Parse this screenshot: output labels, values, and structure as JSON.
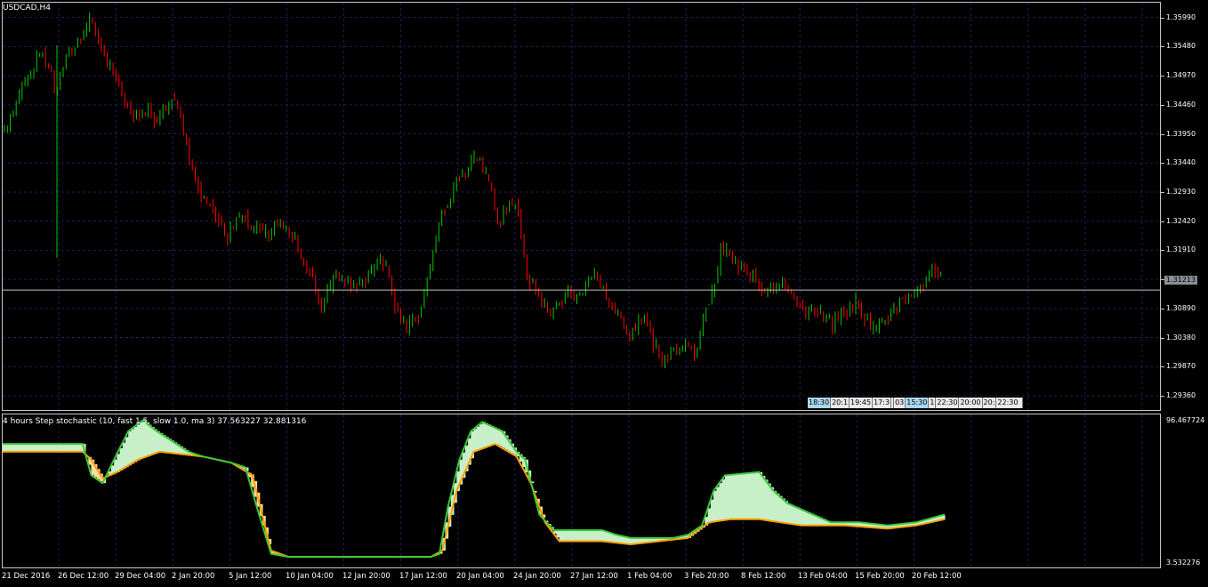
{
  "chart": {
    "symbol_title": "USDCAD,H4",
    "current_price": "1.31213",
    "price_labels": [
      "1.35990",
      "1.35480",
      "1.34970",
      "1.34460",
      "1.33950",
      "1.33440",
      "1.32930",
      "1.32420",
      "1.31910",
      "1.31400",
      "1.30890",
      "1.30380",
      "1.29870",
      "1.29360"
    ],
    "time_labels": [
      "21 Dec 2016",
      "26 Dec 12:00",
      "29 Dec 04:00",
      "2 Jan 20:00",
      "5 Jan 12:00",
      "10 Jan 04:00",
      "12 Jan 20:00",
      "17 Jan 12:00",
      "20 Jan 04:00",
      "24 Jan 20:00",
      "27 Jan 12:00",
      "1 Feb 04:00",
      "3 Feb 20:00",
      "8 Feb 12:00",
      "13 Feb 04:00",
      "15 Feb 20:00",
      "20 Feb 12:00"
    ],
    "event_markers": [
      {
        "label": "18:30",
        "highlight": true
      },
      {
        "label": "20:1",
        "highlight": false
      },
      {
        "label": "19:45",
        "highlight": false
      },
      {
        "label": "17:3",
        "highlight": false
      },
      {
        "label": "",
        "highlight": false
      },
      {
        "label": "03",
        "highlight": false
      },
      {
        "label": "15:30",
        "highlight": true
      },
      {
        "label": "1",
        "highlight": false
      },
      {
        "label": "22:30",
        "highlight": false
      },
      {
        "label": "20:00",
        "highlight": false
      },
      {
        "label": "20:",
        "highlight": false
      },
      {
        "label": "22:30",
        "highlight": false
      }
    ],
    "colors": {
      "bull": "#00c800",
      "bear": "#ff0000",
      "grid": "#1e1e5a",
      "current_line": "#c0c0c0"
    }
  },
  "indicator": {
    "title": "4 hours Step stochastic (10, fast 1.5, slow 1.0, ma 3) 37.563227 32.881316",
    "max_label": "96.467724",
    "min_label": "3.532276",
    "colors": {
      "main": "#3cc83c",
      "signal": "#ffa000",
      "fill_up": "#c8f0c8",
      "fill_down": "#ffdca0"
    }
  },
  "chart_data": {
    "type": "candlestick",
    "title": "USDCAD,H4",
    "ylim": [
      1.2911,
      1.3625
    ],
    "current_price": 1.31213,
    "close_path": [
      [
        0,
        1.34
      ],
      [
        6,
        1.344
      ],
      [
        12,
        1.348
      ],
      [
        18,
        1.35
      ],
      [
        24,
        1.354
      ],
      [
        30,
        1.351
      ],
      [
        36,
        1.347
      ],
      [
        42,
        1.352
      ],
      [
        48,
        1.3545
      ],
      [
        54,
        1.357
      ],
      [
        60,
        1.36
      ],
      [
        66,
        1.356
      ],
      [
        72,
        1.352
      ],
      [
        78,
        1.349
      ],
      [
        84,
        1.345
      ],
      [
        90,
        1.343
      ],
      [
        96,
        1.342
      ],
      [
        102,
        1.344
      ],
      [
        108,
        1.341
      ],
      [
        114,
        1.345
      ],
      [
        120,
        1.346
      ],
      [
        126,
        1.34
      ],
      [
        132,
        1.333
      ],
      [
        138,
        1.329
      ],
      [
        144,
        1.327
      ],
      [
        150,
        1.325
      ],
      [
        156,
        1.321
      ],
      [
        162,
        1.324
      ],
      [
        168,
        1.325
      ],
      [
        174,
        1.322
      ],
      [
        180,
        1.323
      ],
      [
        186,
        1.3215
      ],
      [
        192,
        1.324
      ],
      [
        198,
        1.3225
      ],
      [
        204,
        1.321
      ],
      [
        210,
        1.317
      ],
      [
        216,
        1.314
      ],
      [
        222,
        1.309
      ],
      [
        228,
        1.313
      ],
      [
        234,
        1.315
      ],
      [
        240,
        1.314
      ],
      [
        246,
        1.3135
      ],
      [
        252,
        1.313
      ],
      [
        258,
        1.316
      ],
      [
        264,
        1.318
      ],
      [
        270,
        1.314
      ],
      [
        276,
        1.308
      ],
      [
        282,
        1.3055
      ],
      [
        288,
        1.307
      ],
      [
        294,
        1.309
      ],
      [
        300,
        1.318
      ],
      [
        306,
        1.325
      ],
      [
        312,
        1.328
      ],
      [
        318,
        1.332
      ],
      [
        324,
        1.333
      ],
      [
        330,
        1.336
      ],
      [
        336,
        1.333
      ],
      [
        342,
        1.329
      ],
      [
        348,
        1.324
      ],
      [
        354,
        1.327
      ],
      [
        360,
        1.328
      ],
      [
        366,
        1.315
      ],
      [
        372,
        1.313
      ],
      [
        378,
        1.31
      ],
      [
        384,
        1.308
      ],
      [
        390,
        1.31
      ],
      [
        396,
        1.312
      ],
      [
        402,
        1.311
      ],
      [
        408,
        1.313
      ],
      [
        414,
        1.315
      ],
      [
        420,
        1.313
      ],
      [
        426,
        1.309
      ],
      [
        432,
        1.307
      ],
      [
        438,
        1.304
      ],
      [
        444,
        1.306
      ],
      [
        450,
        1.308
      ],
      [
        456,
        1.303
      ],
      [
        462,
        1.3
      ],
      [
        468,
        1.302
      ],
      [
        474,
        1.301
      ],
      [
        480,
        1.303
      ],
      [
        486,
        1.301
      ],
      [
        492,
        1.308
      ],
      [
        498,
        1.313
      ],
      [
        504,
        1.319
      ],
      [
        510,
        1.318
      ],
      [
        516,
        1.316
      ],
      [
        522,
        1.315
      ],
      [
        528,
        1.314
      ],
      [
        534,
        1.312
      ],
      [
        540,
        1.313
      ],
      [
        546,
        1.314
      ],
      [
        552,
        1.311
      ],
      [
        558,
        1.31
      ],
      [
        564,
        1.308
      ],
      [
        570,
        1.309
      ],
      [
        576,
        1.307
      ],
      [
        582,
        1.306
      ],
      [
        588,
        1.308
      ],
      [
        594,
        1.309
      ],
      [
        600,
        1.31
      ],
      [
        606,
        1.307
      ],
      [
        612,
        1.305
      ],
      [
        618,
        1.307
      ],
      [
        624,
        1.309
      ],
      [
        630,
        1.311
      ],
      [
        636,
        1.3105
      ],
      [
        642,
        1.312
      ],
      [
        648,
        1.314
      ],
      [
        654,
        1.316
      ],
      [
        660,
        1.314
      ]
    ],
    "stochastic": {
      "ylim": [
        3.532276,
        96.467724
      ],
      "main": [
        [
          0,
          80
        ],
        [
          56,
          80
        ],
        [
          62,
          60
        ],
        [
          70,
          55
        ],
        [
          78,
          70
        ],
        [
          88,
          88
        ],
        [
          98,
          95
        ],
        [
          108,
          88
        ],
        [
          130,
          75
        ],
        [
          140,
          72
        ],
        [
          150,
          70
        ],
        [
          160,
          68
        ],
        [
          170,
          65
        ],
        [
          178,
          40
        ],
        [
          188,
          10
        ],
        [
          200,
          8
        ],
        [
          300,
          8
        ],
        [
          306,
          10
        ],
        [
          312,
          40
        ],
        [
          320,
          70
        ],
        [
          328,
          88
        ],
        [
          336,
          94
        ],
        [
          350,
          88
        ],
        [
          360,
          75
        ],
        [
          366,
          70
        ],
        [
          376,
          35
        ],
        [
          386,
          25
        ],
        [
          420,
          25
        ],
        [
          430,
          22
        ],
        [
          440,
          20
        ],
        [
          450,
          20
        ],
        [
          470,
          20
        ],
        [
          480,
          22
        ],
        [
          490,
          28
        ],
        [
          498,
          50
        ],
        [
          506,
          60
        ],
        [
          530,
          62
        ],
        [
          540,
          50
        ],
        [
          550,
          42
        ],
        [
          580,
          30
        ],
        [
          600,
          30
        ],
        [
          620,
          28
        ],
        [
          640,
          30
        ],
        [
          660,
          35
        ]
      ],
      "signal": [
        [
          0,
          75
        ],
        [
          56,
          75
        ],
        [
          62,
          70
        ],
        [
          70,
          58
        ],
        [
          80,
          62
        ],
        [
          95,
          70
        ],
        [
          110,
          75
        ],
        [
          140,
          72
        ],
        [
          160,
          68
        ],
        [
          175,
          60
        ],
        [
          188,
          12
        ],
        [
          200,
          8
        ],
        [
          300,
          8
        ],
        [
          308,
          12
        ],
        [
          318,
          50
        ],
        [
          330,
          75
        ],
        [
          345,
          80
        ],
        [
          360,
          72
        ],
        [
          370,
          55
        ],
        [
          380,
          30
        ],
        [
          390,
          18
        ],
        [
          420,
          18
        ],
        [
          440,
          16
        ],
        [
          460,
          18
        ],
        [
          480,
          20
        ],
        [
          495,
          30
        ],
        [
          510,
          32
        ],
        [
          530,
          32
        ],
        [
          545,
          30
        ],
        [
          560,
          28
        ],
        [
          590,
          28
        ],
        [
          620,
          26
        ],
        [
          640,
          28
        ],
        [
          660,
          32
        ]
      ]
    }
  }
}
